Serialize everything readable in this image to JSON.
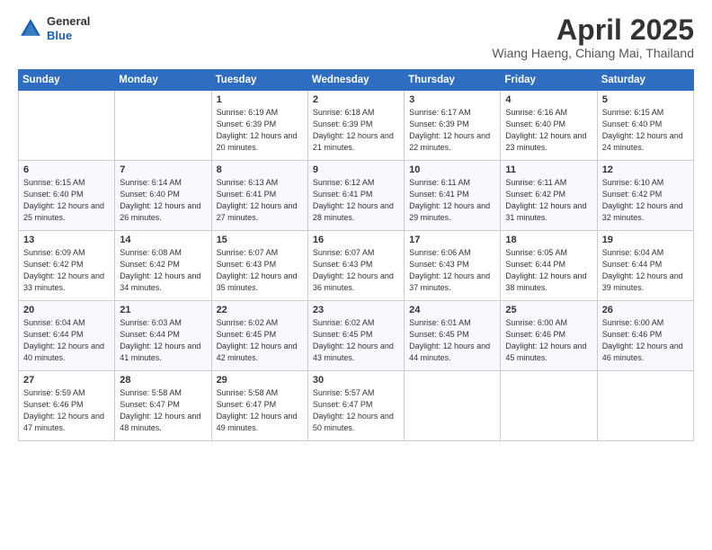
{
  "header": {
    "logo": {
      "general": "General",
      "blue": "Blue"
    },
    "title": "April 2025",
    "location": "Wiang Haeng, Chiang Mai, Thailand"
  },
  "days_of_week": [
    "Sunday",
    "Monday",
    "Tuesday",
    "Wednesday",
    "Thursday",
    "Friday",
    "Saturday"
  ],
  "weeks": [
    [
      {
        "day": "",
        "sunrise": "",
        "sunset": "",
        "daylight": ""
      },
      {
        "day": "",
        "sunrise": "",
        "sunset": "",
        "daylight": ""
      },
      {
        "day": "1",
        "sunrise": "Sunrise: 6:19 AM",
        "sunset": "Sunset: 6:39 PM",
        "daylight": "Daylight: 12 hours and 20 minutes."
      },
      {
        "day": "2",
        "sunrise": "Sunrise: 6:18 AM",
        "sunset": "Sunset: 6:39 PM",
        "daylight": "Daylight: 12 hours and 21 minutes."
      },
      {
        "day": "3",
        "sunrise": "Sunrise: 6:17 AM",
        "sunset": "Sunset: 6:39 PM",
        "daylight": "Daylight: 12 hours and 22 minutes."
      },
      {
        "day": "4",
        "sunrise": "Sunrise: 6:16 AM",
        "sunset": "Sunset: 6:40 PM",
        "daylight": "Daylight: 12 hours and 23 minutes."
      },
      {
        "day": "5",
        "sunrise": "Sunrise: 6:15 AM",
        "sunset": "Sunset: 6:40 PM",
        "daylight": "Daylight: 12 hours and 24 minutes."
      }
    ],
    [
      {
        "day": "6",
        "sunrise": "Sunrise: 6:15 AM",
        "sunset": "Sunset: 6:40 PM",
        "daylight": "Daylight: 12 hours and 25 minutes."
      },
      {
        "day": "7",
        "sunrise": "Sunrise: 6:14 AM",
        "sunset": "Sunset: 6:40 PM",
        "daylight": "Daylight: 12 hours and 26 minutes."
      },
      {
        "day": "8",
        "sunrise": "Sunrise: 6:13 AM",
        "sunset": "Sunset: 6:41 PM",
        "daylight": "Daylight: 12 hours and 27 minutes."
      },
      {
        "day": "9",
        "sunrise": "Sunrise: 6:12 AM",
        "sunset": "Sunset: 6:41 PM",
        "daylight": "Daylight: 12 hours and 28 minutes."
      },
      {
        "day": "10",
        "sunrise": "Sunrise: 6:11 AM",
        "sunset": "Sunset: 6:41 PM",
        "daylight": "Daylight: 12 hours and 29 minutes."
      },
      {
        "day": "11",
        "sunrise": "Sunrise: 6:11 AM",
        "sunset": "Sunset: 6:42 PM",
        "daylight": "Daylight: 12 hours and 31 minutes."
      },
      {
        "day": "12",
        "sunrise": "Sunrise: 6:10 AM",
        "sunset": "Sunset: 6:42 PM",
        "daylight": "Daylight: 12 hours and 32 minutes."
      }
    ],
    [
      {
        "day": "13",
        "sunrise": "Sunrise: 6:09 AM",
        "sunset": "Sunset: 6:42 PM",
        "daylight": "Daylight: 12 hours and 33 minutes."
      },
      {
        "day": "14",
        "sunrise": "Sunrise: 6:08 AM",
        "sunset": "Sunset: 6:42 PM",
        "daylight": "Daylight: 12 hours and 34 minutes."
      },
      {
        "day": "15",
        "sunrise": "Sunrise: 6:07 AM",
        "sunset": "Sunset: 6:43 PM",
        "daylight": "Daylight: 12 hours and 35 minutes."
      },
      {
        "day": "16",
        "sunrise": "Sunrise: 6:07 AM",
        "sunset": "Sunset: 6:43 PM",
        "daylight": "Daylight: 12 hours and 36 minutes."
      },
      {
        "day": "17",
        "sunrise": "Sunrise: 6:06 AM",
        "sunset": "Sunset: 6:43 PM",
        "daylight": "Daylight: 12 hours and 37 minutes."
      },
      {
        "day": "18",
        "sunrise": "Sunrise: 6:05 AM",
        "sunset": "Sunset: 6:44 PM",
        "daylight": "Daylight: 12 hours and 38 minutes."
      },
      {
        "day": "19",
        "sunrise": "Sunrise: 6:04 AM",
        "sunset": "Sunset: 6:44 PM",
        "daylight": "Daylight: 12 hours and 39 minutes."
      }
    ],
    [
      {
        "day": "20",
        "sunrise": "Sunrise: 6:04 AM",
        "sunset": "Sunset: 6:44 PM",
        "daylight": "Daylight: 12 hours and 40 minutes."
      },
      {
        "day": "21",
        "sunrise": "Sunrise: 6:03 AM",
        "sunset": "Sunset: 6:44 PM",
        "daylight": "Daylight: 12 hours and 41 minutes."
      },
      {
        "day": "22",
        "sunrise": "Sunrise: 6:02 AM",
        "sunset": "Sunset: 6:45 PM",
        "daylight": "Daylight: 12 hours and 42 minutes."
      },
      {
        "day": "23",
        "sunrise": "Sunrise: 6:02 AM",
        "sunset": "Sunset: 6:45 PM",
        "daylight": "Daylight: 12 hours and 43 minutes."
      },
      {
        "day": "24",
        "sunrise": "Sunrise: 6:01 AM",
        "sunset": "Sunset: 6:45 PM",
        "daylight": "Daylight: 12 hours and 44 minutes."
      },
      {
        "day": "25",
        "sunrise": "Sunrise: 6:00 AM",
        "sunset": "Sunset: 6:46 PM",
        "daylight": "Daylight: 12 hours and 45 minutes."
      },
      {
        "day": "26",
        "sunrise": "Sunrise: 6:00 AM",
        "sunset": "Sunset: 6:46 PM",
        "daylight": "Daylight: 12 hours and 46 minutes."
      }
    ],
    [
      {
        "day": "27",
        "sunrise": "Sunrise: 5:59 AM",
        "sunset": "Sunset: 6:46 PM",
        "daylight": "Daylight: 12 hours and 47 minutes."
      },
      {
        "day": "28",
        "sunrise": "Sunrise: 5:58 AM",
        "sunset": "Sunset: 6:47 PM",
        "daylight": "Daylight: 12 hours and 48 minutes."
      },
      {
        "day": "29",
        "sunrise": "Sunrise: 5:58 AM",
        "sunset": "Sunset: 6:47 PM",
        "daylight": "Daylight: 12 hours and 49 minutes."
      },
      {
        "day": "30",
        "sunrise": "Sunrise: 5:57 AM",
        "sunset": "Sunset: 6:47 PM",
        "daylight": "Daylight: 12 hours and 50 minutes."
      },
      {
        "day": "",
        "sunrise": "",
        "sunset": "",
        "daylight": ""
      },
      {
        "day": "",
        "sunrise": "",
        "sunset": "",
        "daylight": ""
      },
      {
        "day": "",
        "sunrise": "",
        "sunset": "",
        "daylight": ""
      }
    ]
  ]
}
